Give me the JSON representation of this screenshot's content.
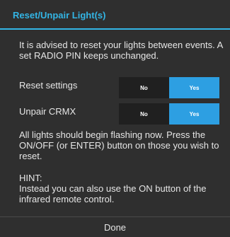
{
  "dialog": {
    "title": "Reset/Unpair Light(s)",
    "intro": "It is advised to reset your lights between events. A set RADIO PIN keeps unchanged.",
    "reset_settings": {
      "label": "Reset settings",
      "no_label": "No",
      "yes_label": "Yes",
      "selected": "Yes"
    },
    "unpair_crmx": {
      "label": "Unpair CRMX",
      "no_label": "No",
      "yes_label": "Yes",
      "selected": "Yes"
    },
    "flashing_text": "All lights should begin flashing now. Press the ON/OFF (or ENTER) button on those you wish to reset.",
    "hint_heading": "HINT:",
    "hint_text": "Instead you can also use the ON button of the infrared remote control.",
    "done_label": "Done"
  },
  "colors": {
    "accent": "#33b5e5",
    "toggle_selected": "#2d9fe2",
    "toggle_unselected": "#202020",
    "background": "#2f2f2f"
  }
}
